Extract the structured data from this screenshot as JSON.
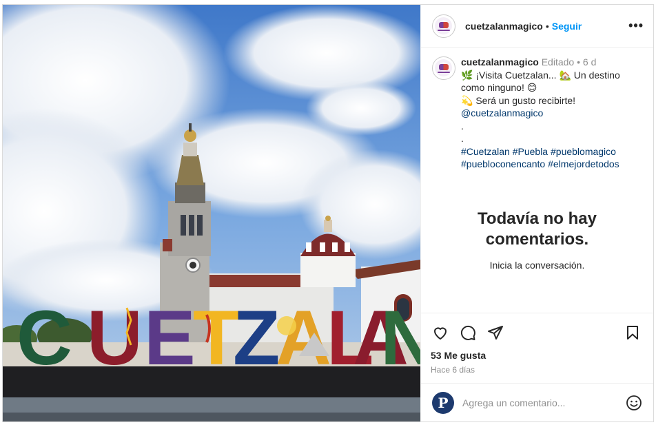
{
  "post": {
    "username": "cuetzalanmagico",
    "follow_label": "Seguir",
    "more_label": "•••",
    "caption": {
      "username": "cuetzalanmagico",
      "edited": "Editado",
      "age": "6 d",
      "line1_a": "¡Visita Cuetzalan...",
      "line1_b": "Un destino como ninguno!",
      "line2": "Será un gusto recibirte!",
      "mention": "@cuetzalanmagico",
      "dot1": ".",
      "dot2": ".",
      "hashtags": [
        "#Cuetzalan",
        "#Puebla",
        "#pueblomagico",
        "#puebloconencanto",
        "#elmejordetodos"
      ]
    },
    "empty_title": "Todavía no hay comentarios.",
    "empty_sub": "Inicia la conversación.",
    "likes": "53 Me gusta",
    "timestamp": "Hace 6 días",
    "comment_placeholder": "Agrega un comentario...",
    "my_avatar_letter": "P",
    "photo_sign": "CUETZALAN",
    "colors": {
      "link": "#00376b",
      "follow": "#0095f6",
      "muted": "#8e8e8e",
      "sky": "#5b8fd6"
    }
  }
}
